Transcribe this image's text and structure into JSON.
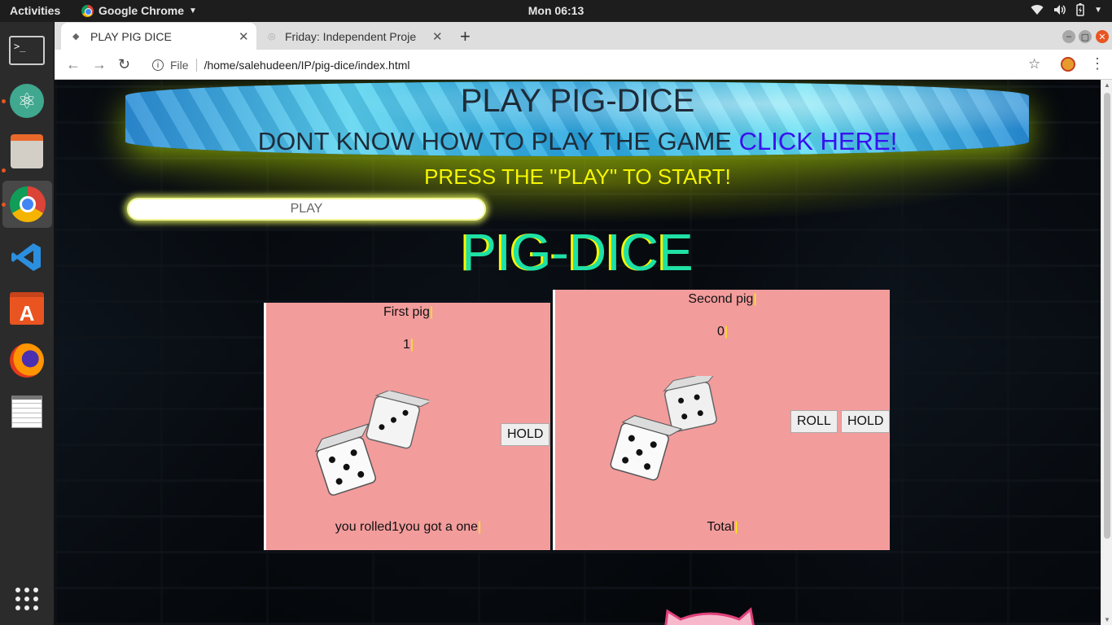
{
  "system": {
    "activities": "Activities",
    "app_name": "Google Chrome",
    "clock": "Mon 06:13"
  },
  "browser": {
    "tabs": [
      {
        "title": "PLAY PIG DICE"
      },
      {
        "title": "Friday: Independent Proje"
      }
    ],
    "address_prefix": "File",
    "url": "/home/salehudeen/IP/pig-dice/index.html"
  },
  "page": {
    "title": "PLAY PIG-DICE",
    "help_text": "DONT KNOW HOW TO PLAY THE GAME",
    "help_link": "CLICK HERE!",
    "instruction": "PRESS THE \"PLAY\" TO START!",
    "play_button": "PLAY",
    "game_title": "PIG-DICE"
  },
  "player1": {
    "name": "First pig",
    "score": "1",
    "hold_button": "HOLD",
    "message": "you rolled1you got a one"
  },
  "player2": {
    "name": "Second pig",
    "score": "0",
    "roll_button": "ROLL",
    "hold_button": "HOLD",
    "total_label": "Total"
  },
  "colors": {
    "panel": "#f39c9c",
    "instruction_yellow": "#f6f600",
    "game_title_green": "#1de1a6",
    "link_blue": "#3a10f0"
  }
}
